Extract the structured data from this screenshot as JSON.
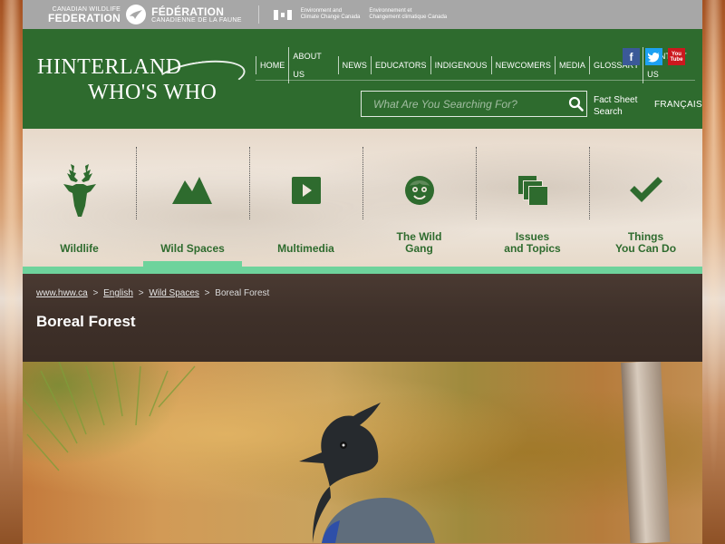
{
  "partners": {
    "cwf_en_small": "CANADIAN WILDLIFE",
    "cwf_en_big": "FEDERATION",
    "cwf_fr_big": "FÉDÉRATION",
    "cwf_fr_small": "CANADIENNE DE LA FAUNE",
    "eccc_en_1": "Environment and",
    "eccc_en_2": "Climate Change Canada",
    "eccc_fr_1": "Environnement et",
    "eccc_fr_2": "Changement climatique Canada"
  },
  "logo": {
    "line1": "HINTERLAND",
    "line2": "WHO'S WHO"
  },
  "topnav": {
    "items": [
      "HOME",
      "ABOUT US",
      "NEWS",
      "EDUCATORS",
      "INDIGENOUS",
      "NEWCOMERS",
      "MEDIA",
      "GLOSSARY",
      "CONTACT US"
    ]
  },
  "social": {
    "facebook": "f",
    "twitter": "t",
    "youtube_1": "You",
    "youtube_2": "Tube"
  },
  "search": {
    "placeholder": "What Are You Searching For?",
    "fact_sheet_1": "Fact Sheet",
    "fact_sheet_2": "Search"
  },
  "language_toggle": "FRANÇAIS",
  "categories": [
    {
      "label": "Wildlife",
      "icon": "deer-icon",
      "active": false
    },
    {
      "label": "Wild Spaces",
      "icon": "mountain-icon",
      "active": true
    },
    {
      "label": "Multimedia",
      "icon": "play-icon",
      "active": false
    },
    {
      "label_1": "The Wild",
      "label_2": "Gang",
      "icon": "face-icon",
      "active": false
    },
    {
      "label_1": "Issues",
      "label_2": "and Topics",
      "icon": "stack-icon",
      "active": false
    },
    {
      "label_1": "Things",
      "label_2": "You Can Do",
      "icon": "checkmark-icon",
      "active": false
    }
  ],
  "breadcrumb": {
    "home": "www.hww.ca",
    "lang": "English",
    "section": "Wild Spaces",
    "current": "Boreal Forest",
    "sep": ">"
  },
  "page_title": "Boreal Forest",
  "colors": {
    "header_green": "#2e6b2e",
    "accent_mint": "#6ed39c",
    "partner_grey": "#a7a7a7",
    "title_band": "#3e3029"
  }
}
